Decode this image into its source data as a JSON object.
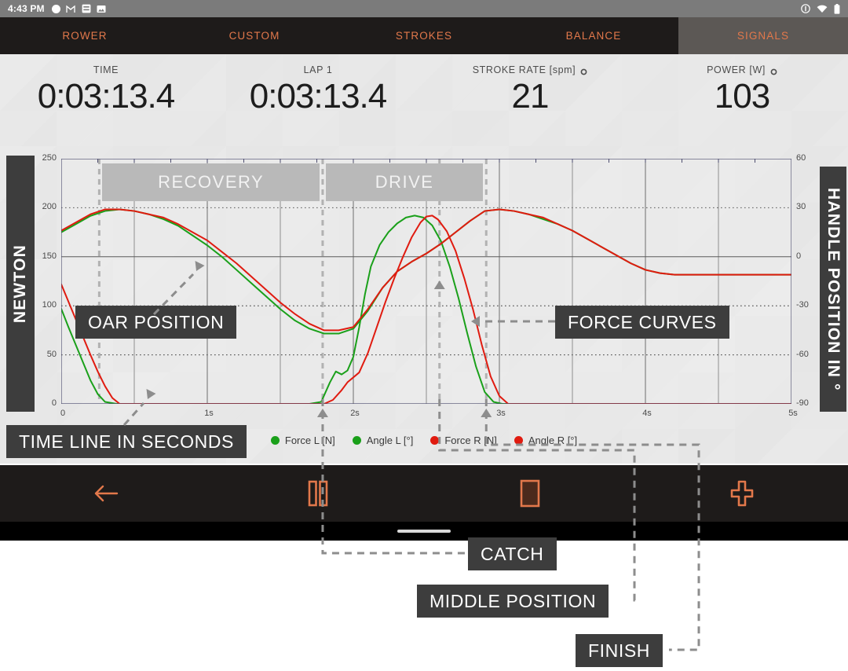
{
  "statusbar": {
    "time": "4:43 PM",
    "left_icons": [
      "circle-icon",
      "gmail-icon",
      "note-icon",
      "image-icon"
    ],
    "right_icons": [
      "alert-icon",
      "wifi-icon",
      "battery-icon"
    ]
  },
  "tabs": [
    {
      "label": "ROWER",
      "active": false
    },
    {
      "label": "CUSTOM",
      "active": false
    },
    {
      "label": "STROKES",
      "active": false
    },
    {
      "label": "BALANCE",
      "active": false
    },
    {
      "label": "SIGNALS",
      "active": true
    }
  ],
  "metrics": [
    {
      "label": "TIME",
      "value": "0:03:13.4",
      "has_gear": false
    },
    {
      "label": "LAP 1",
      "value": "0:03:13.4",
      "has_gear": false
    },
    {
      "label": "STROKE RATE [spm]",
      "value": "21",
      "has_gear": true
    },
    {
      "label": "POWER [W]",
      "value": "103",
      "has_gear": true
    }
  ],
  "axes": {
    "left_title": "NEWTON",
    "right_title": "HANDLE POSITION IN °"
  },
  "phases": [
    {
      "label": "RECOVERY"
    },
    {
      "label": "DRIVE"
    }
  ],
  "callouts": {
    "oar_position": "OAR POSITION",
    "force_curves": "FORCE CURVES",
    "time_line": "TIME LINE IN SECONDS",
    "catch": "CATCH",
    "middle_position": "MIDDLE POSITION",
    "finish": "FINISH"
  },
  "legend": [
    {
      "label": "Force L [N]",
      "color": "#1aa01a"
    },
    {
      "label": "Angle L [°]",
      "color": "#1aa01a"
    },
    {
      "label": "Force R [N]",
      "color": "#e01b10"
    },
    {
      "label": "Angle R [°]",
      "color": "#e01b10"
    }
  ],
  "toolbar": [
    {
      "name": "back-button",
      "icon": "arrow-left-icon"
    },
    {
      "name": "pause-button",
      "icon": "pause-icon"
    },
    {
      "name": "stop-button",
      "icon": "stop-square-icon"
    },
    {
      "name": "add-button",
      "icon": "plus-cross-icon"
    }
  ],
  "colors": {
    "accent": "#e2784b",
    "left_series": "#1aa01a",
    "right_series": "#e01b10",
    "dark_panel": "#3d3d3d",
    "tabbar": "#1e1b1a",
    "chart_bg": "#ececec"
  },
  "chart_data": {
    "type": "line",
    "title": "",
    "xlabel": "",
    "ylabel": "NEWTON",
    "y2label": "HANDLE POSITION IN °",
    "grid": true,
    "legend_position": "bottom",
    "x": [
      0,
      1,
      2,
      3,
      4,
      5
    ],
    "xticklabels": [
      "0",
      "1s",
      "2s",
      "3s",
      "4s",
      "5s"
    ],
    "xlim": [
      0,
      5
    ],
    "ylim": [
      0,
      250
    ],
    "yticks": [
      0,
      50,
      100,
      150,
      200,
      250
    ],
    "y2lim": [
      -90,
      60
    ],
    "y2ticks": [
      -90,
      -60,
      -30,
      0,
      30,
      60
    ],
    "markers": [
      {
        "label": "CATCH",
        "x": 1.79
      },
      {
        "label": "MIDDLE POSITION",
        "x": 2.59
      },
      {
        "label": "FINISH",
        "x": 2.91
      },
      {
        "label": "RECOVERY_START",
        "x": 0.26
      }
    ],
    "phase_spans": [
      {
        "label": "RECOVERY",
        "x0": 0.26,
        "x1": 1.79
      },
      {
        "label": "DRIVE",
        "x0": 1.79,
        "x1": 2.91
      }
    ],
    "series": [
      {
        "name": "Force L [N]",
        "axis": "left",
        "color": "#1aa01a",
        "points": [
          [
            0.0,
            97
          ],
          [
            0.05,
            78
          ],
          [
            0.1,
            60
          ],
          [
            0.15,
            42
          ],
          [
            0.2,
            24
          ],
          [
            0.25,
            10
          ],
          [
            0.3,
            2
          ],
          [
            0.38,
            0
          ],
          [
            0.6,
            0
          ],
          [
            1.0,
            0
          ],
          [
            1.4,
            0
          ],
          [
            1.7,
            0
          ],
          [
            1.78,
            2
          ],
          [
            1.84,
            22
          ],
          [
            1.88,
            33
          ],
          [
            1.92,
            30
          ],
          [
            1.96,
            34
          ],
          [
            2.0,
            48
          ],
          [
            2.04,
            78
          ],
          [
            2.08,
            112
          ],
          [
            2.12,
            140
          ],
          [
            2.18,
            162
          ],
          [
            2.24,
            175
          ],
          [
            2.3,
            184
          ],
          [
            2.36,
            190
          ],
          [
            2.42,
            192
          ],
          [
            2.48,
            190
          ],
          [
            2.54,
            182
          ],
          [
            2.6,
            166
          ],
          [
            2.66,
            140
          ],
          [
            2.72,
            108
          ],
          [
            2.78,
            72
          ],
          [
            2.84,
            38
          ],
          [
            2.9,
            12
          ],
          [
            2.96,
            2
          ],
          [
            3.02,
            0
          ],
          [
            3.4,
            0
          ],
          [
            4.0,
            0
          ],
          [
            4.6,
            0
          ],
          [
            5.0,
            0
          ]
        ]
      },
      {
        "name": "Angle L [°]",
        "axis": "right",
        "color": "#1aa01a",
        "points": [
          [
            0.0,
            15
          ],
          [
            0.1,
            20
          ],
          [
            0.2,
            25
          ],
          [
            0.3,
            28
          ],
          [
            0.4,
            29
          ],
          [
            0.5,
            28
          ],
          [
            0.6,
            26
          ],
          [
            0.7,
            23
          ],
          [
            0.8,
            19
          ],
          [
            0.9,
            13
          ],
          [
            1.0,
            7
          ],
          [
            1.1,
            0
          ],
          [
            1.2,
            -8
          ],
          [
            1.3,
            -16
          ],
          [
            1.4,
            -24
          ],
          [
            1.5,
            -32
          ],
          [
            1.6,
            -39
          ],
          [
            1.7,
            -44
          ],
          [
            1.8,
            -47
          ],
          [
            1.9,
            -47
          ],
          [
            2.0,
            -44
          ],
          [
            2.1,
            -33
          ],
          [
            2.2,
            -19
          ],
          [
            2.3,
            -9
          ],
          [
            2.4,
            -3
          ],
          [
            2.5,
            2
          ],
          [
            2.6,
            8
          ],
          [
            2.7,
            15
          ],
          [
            2.8,
            22
          ],
          [
            2.9,
            28
          ],
          [
            3.0,
            29
          ],
          [
            3.1,
            28
          ],
          [
            3.2,
            26
          ],
          [
            3.3,
            23
          ],
          [
            3.4,
            20
          ],
          [
            3.5,
            16
          ],
          [
            3.6,
            11
          ],
          [
            3.7,
            6
          ],
          [
            3.8,
            1
          ],
          [
            3.9,
            -4
          ],
          [
            4.0,
            -8
          ],
          [
            4.1,
            -10
          ],
          [
            4.2,
            -11
          ],
          [
            4.4,
            -11
          ],
          [
            4.6,
            -11
          ],
          [
            5.0,
            -11
          ]
        ]
      },
      {
        "name": "Force R [N]",
        "axis": "left",
        "color": "#e01b10",
        "points": [
          [
            0.0,
            122
          ],
          [
            0.05,
            104
          ],
          [
            0.1,
            86
          ],
          [
            0.15,
            68
          ],
          [
            0.2,
            50
          ],
          [
            0.25,
            33
          ],
          [
            0.3,
            18
          ],
          [
            0.35,
            6
          ],
          [
            0.4,
            0
          ],
          [
            0.6,
            0
          ],
          [
            1.0,
            0
          ],
          [
            1.4,
            0
          ],
          [
            1.8,
            0
          ],
          [
            1.86,
            4
          ],
          [
            1.92,
            14
          ],
          [
            1.96,
            22
          ],
          [
            2.0,
            27
          ],
          [
            2.04,
            32
          ],
          [
            2.1,
            52
          ],
          [
            2.16,
            78
          ],
          [
            2.22,
            104
          ],
          [
            2.28,
            128
          ],
          [
            2.34,
            150
          ],
          [
            2.4,
            170
          ],
          [
            2.46,
            185
          ],
          [
            2.5,
            191
          ],
          [
            2.54,
            192
          ],
          [
            2.58,
            188
          ],
          [
            2.64,
            176
          ],
          [
            2.7,
            156
          ],
          [
            2.76,
            128
          ],
          [
            2.82,
            96
          ],
          [
            2.88,
            60
          ],
          [
            2.94,
            28
          ],
          [
            3.0,
            8
          ],
          [
            3.06,
            0
          ],
          [
            3.4,
            0
          ],
          [
            4.0,
            0
          ],
          [
            4.6,
            0
          ],
          [
            5.0,
            0
          ]
        ]
      },
      {
        "name": "Angle R [°]",
        "axis": "right",
        "color": "#e01b10",
        "points": [
          [
            0.0,
            16
          ],
          [
            0.1,
            21
          ],
          [
            0.2,
            26
          ],
          [
            0.3,
            29
          ],
          [
            0.4,
            29
          ],
          [
            0.5,
            28
          ],
          [
            0.6,
            26
          ],
          [
            0.7,
            24
          ],
          [
            0.8,
            20
          ],
          [
            0.9,
            15
          ],
          [
            1.0,
            10
          ],
          [
            1.1,
            3
          ],
          [
            1.2,
            -4
          ],
          [
            1.3,
            -12
          ],
          [
            1.4,
            -20
          ],
          [
            1.5,
            -28
          ],
          [
            1.6,
            -35
          ],
          [
            1.7,
            -41
          ],
          [
            1.8,
            -45
          ],
          [
            1.9,
            -45
          ],
          [
            2.0,
            -43
          ],
          [
            2.1,
            -32
          ],
          [
            2.2,
            -19
          ],
          [
            2.3,
            -9
          ],
          [
            2.4,
            -3
          ],
          [
            2.5,
            2
          ],
          [
            2.6,
            8
          ],
          [
            2.7,
            15
          ],
          [
            2.8,
            22
          ],
          [
            2.9,
            28
          ],
          [
            3.0,
            29
          ],
          [
            3.1,
            28
          ],
          [
            3.2,
            26
          ],
          [
            3.3,
            24
          ],
          [
            3.4,
            20
          ],
          [
            3.5,
            16
          ],
          [
            3.6,
            11
          ],
          [
            3.7,
            6
          ],
          [
            3.8,
            1
          ],
          [
            3.9,
            -4
          ],
          [
            4.0,
            -8
          ],
          [
            4.1,
            -10
          ],
          [
            4.2,
            -11
          ],
          [
            4.4,
            -11
          ],
          [
            4.6,
            -11
          ],
          [
            5.0,
            -11
          ]
        ]
      }
    ]
  }
}
